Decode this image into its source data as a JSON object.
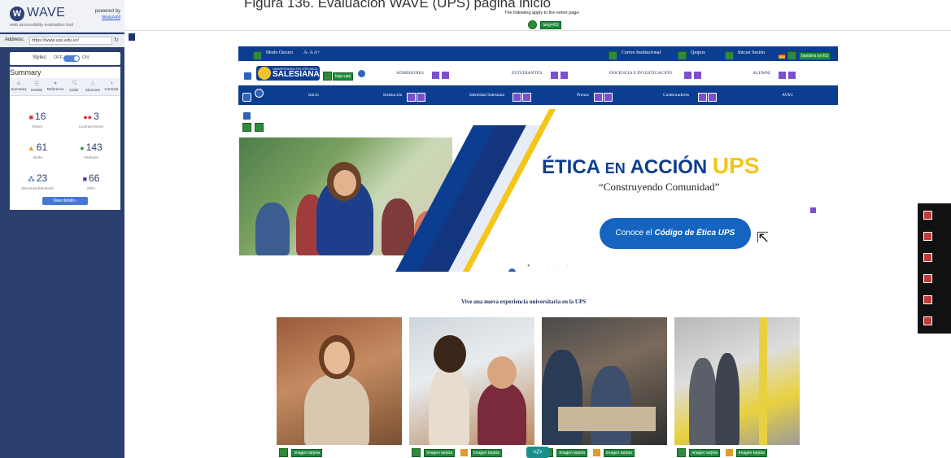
{
  "caption": "Figura 136. Evaluación WAVE (UPS) página inicio",
  "wave": {
    "logo": "WAVE",
    "tagline": "web accessibility evaluation tool",
    "powered_by": "powered by",
    "powered_link": "WebAIM",
    "address_label": "Address:",
    "address_value": "https://www.ups.edu.ec/",
    "styles_label": "Styles:",
    "styles_off": "OFF",
    "styles_on": "ON",
    "summary_title": "Summary",
    "tabs": [
      "Summary",
      "Details",
      "Reference",
      "Order",
      "Structure",
      "Contrast"
    ],
    "stats": {
      "errors": {
        "value": "16",
        "label": "Errors"
      },
      "contrast": {
        "value": "3",
        "label": "Contrast Errors"
      },
      "alerts": {
        "value": "61",
        "label": "Alerts"
      },
      "features": {
        "value": "143",
        "label": "Features"
      },
      "structural": {
        "value": "23",
        "label": "Structural Elements"
      },
      "aria": {
        "value": "66",
        "label": "ARIA"
      }
    },
    "view_details": "View details ›",
    "colors": {
      "errors": "#d33",
      "contrast": "#d33",
      "alerts": "#e89a1c",
      "features": "#2a9d4a",
      "structural": "#2d64b8",
      "aria": "#5b3fa0"
    }
  },
  "page": {
    "apply_note": "The following apply to the entire page:",
    "lang_tag": "lang=ES",
    "topbar": {
      "modo_oscuro": "Modo Oscuro",
      "font_sizes": "A-  A  A+",
      "correo": "Correo Institucional",
      "quipux": "Quipux",
      "iniciar_sesion": "Iniciar Sesión",
      "bandera": "bandera es-ES"
    },
    "logo_tag": "logo-ups",
    "logo_line1": "UNIVERSIDAD POLITÉCNICA",
    "logo_line2": "SALESIANA",
    "main_nav": [
      "ADMISIONES",
      "ESTUDIANTES",
      "DOCENCIA E INVESTIGACIÓN",
      "ALUMNI"
    ],
    "sub_nav": [
      "Inicio",
      "Institución",
      "Identidad Salesiana",
      "Prensa",
      "Colaboradores",
      "AVAC"
    ],
    "hero": {
      "title_a": "ÉTICA",
      "title_b": "EN",
      "title_c": "ACCIÓN",
      "title_d": "UPS",
      "subtitle": "“Construyendo Comunidad”",
      "button_prefix": "Conoce el",
      "button_emph": "Código de Ética UPS"
    },
    "section_title": "Vive una nueva experiencia universitaria en la UPS",
    "card_tag": "imagen tarjeta",
    "code_button": "</>"
  }
}
